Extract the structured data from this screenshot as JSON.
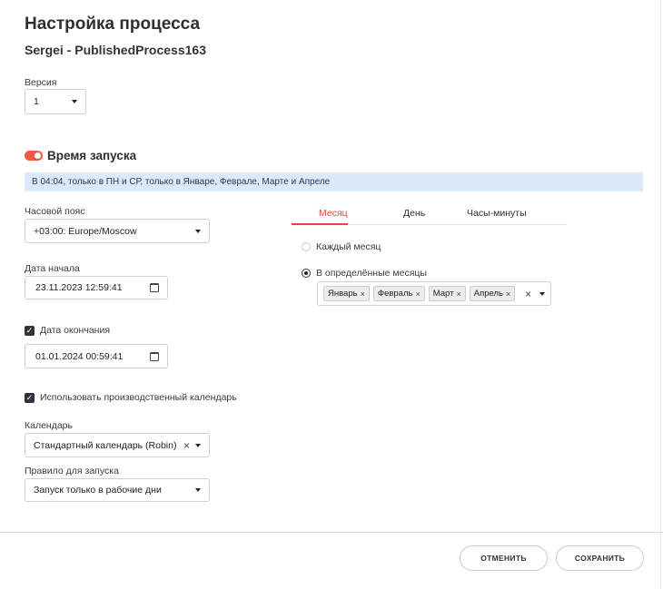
{
  "page": {
    "title": "Настройка процесса",
    "subtitle": "Sergei - PublishedProcess163"
  },
  "version": {
    "label": "Версия",
    "value": "1"
  },
  "schedule": {
    "title": "Время запуска",
    "enabled": true,
    "summary": "В 04:04, только в ПН и СР, только в Январе, Феврале, Марте и Апреле"
  },
  "timezone": {
    "label": "Часовой пояс",
    "value": "+03:00: Europe/Moscow"
  },
  "start_date": {
    "label": "Дата начала",
    "value": "23.11.2023 12:59:41"
  },
  "end_date": {
    "checked": true,
    "label": "Дата окончания",
    "value": "01.01.2024 00:59:41"
  },
  "production_calendar": {
    "checked": true,
    "label": "Использовать производственный календарь"
  },
  "calendar": {
    "label": "Календарь",
    "value": "Стандартный календарь (Robin)"
  },
  "launch_rule": {
    "label": "Правило для запуска",
    "value": "Запуск только в рабочие дни"
  },
  "tabs": [
    {
      "label": "Месяц",
      "active": true
    },
    {
      "label": "День",
      "active": false
    },
    {
      "label": "Часы-минуты",
      "active": false
    }
  ],
  "month_options": {
    "every_month": {
      "label": "Каждый месяц",
      "checked": false
    },
    "specific_months": {
      "label": "В определённые месяцы",
      "checked": true
    }
  },
  "selected_months": [
    "Январь",
    "Февраль",
    "Март",
    "Апрель"
  ],
  "buttons": {
    "cancel": "ОТМЕНИТЬ",
    "save": "СОХРАНИТЬ"
  },
  "colors": {
    "accent": "#e4483a",
    "toggle": "#f05a44",
    "info_bg": "#dbe9fb"
  }
}
